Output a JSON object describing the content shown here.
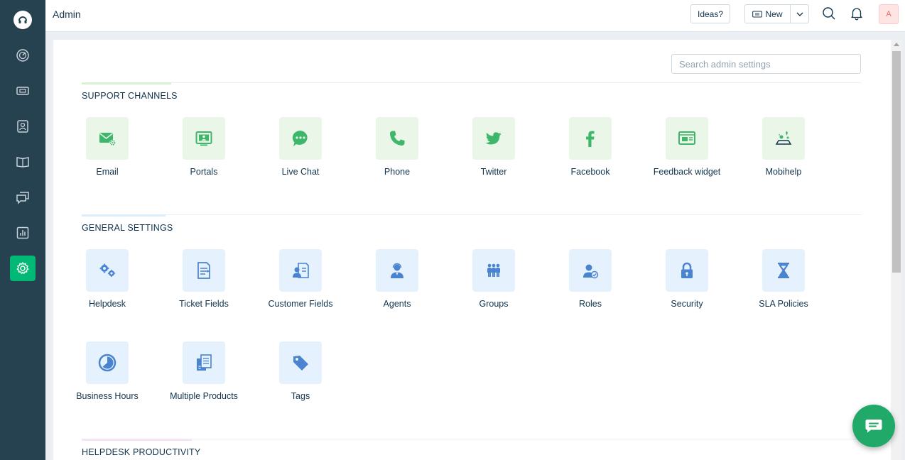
{
  "app": {
    "title": "Admin"
  },
  "header": {
    "ideas_label": "Ideas?",
    "new_label": "New",
    "avatar_initial": "A"
  },
  "search": {
    "placeholder": "Search admin settings"
  },
  "sections": {
    "support_channels": {
      "title": "SUPPORT CHANNELS",
      "accent": "#d9f0d4",
      "items": [
        {
          "label": "Email",
          "icon": "email-icon"
        },
        {
          "label": "Portals",
          "icon": "portal-icon"
        },
        {
          "label": "Live Chat",
          "icon": "chat-bubble-icon"
        },
        {
          "label": "Phone",
          "icon": "phone-icon"
        },
        {
          "label": "Twitter",
          "icon": "twitter-icon"
        },
        {
          "label": "Facebook",
          "icon": "facebook-icon"
        },
        {
          "label": "Feedback widget",
          "icon": "feedback-widget-icon"
        },
        {
          "label": "Mobihelp",
          "icon": "mobihelp-icon"
        }
      ]
    },
    "general_settings": {
      "title": "GENERAL SETTINGS",
      "accent": "#dcedfb",
      "items": [
        {
          "label": "Helpdesk",
          "icon": "gears-icon"
        },
        {
          "label": "Ticket Fields",
          "icon": "ticket-fields-icon"
        },
        {
          "label": "Customer Fields",
          "icon": "customer-fields-icon"
        },
        {
          "label": "Agents",
          "icon": "agent-icon"
        },
        {
          "label": "Groups",
          "icon": "groups-icon"
        },
        {
          "label": "Roles",
          "icon": "roles-icon"
        },
        {
          "label": "Security",
          "icon": "lock-icon"
        },
        {
          "label": "SLA Policies",
          "icon": "hourglass-icon"
        },
        {
          "label": "Business Hours",
          "icon": "clock-icon"
        },
        {
          "label": "Multiple Products",
          "icon": "documents-icon"
        },
        {
          "label": "Tags",
          "icon": "tag-icon"
        }
      ]
    },
    "helpdesk_productivity": {
      "title": "HELPDESK PRODUCTIVITY",
      "accent": "#f5e3f3"
    }
  },
  "colors": {
    "sidebar": "#264251",
    "active_nav": "#02b875",
    "green_icon": "#3fb76a",
    "blue_icon": "#4a83cf",
    "chat": "#21a969"
  }
}
